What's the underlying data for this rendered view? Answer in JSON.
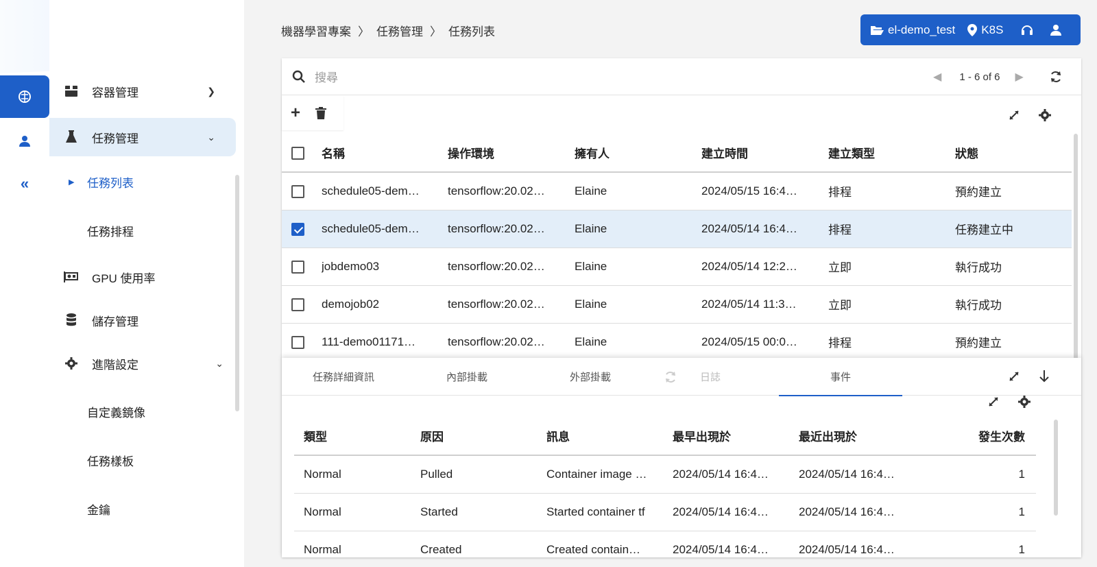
{
  "colors": {
    "primary": "#1e5fc8",
    "selected_row": "#e3eef9",
    "background": "#f3f3f3"
  },
  "rail": {
    "items": [
      "brain-icon",
      "user-icon",
      "double-chevron-left-icon"
    ]
  },
  "sidebar": {
    "items": [
      {
        "label": "容器管理",
        "icon": "box-icon"
      },
      {
        "label": "任務管理",
        "icon": "flask-icon"
      },
      {
        "label": "任務列表"
      },
      {
        "label": "任務排程"
      },
      {
        "label": "GPU 使用率",
        "icon": "gpu-card-icon"
      },
      {
        "label": "儲存管理",
        "icon": "database-icon"
      },
      {
        "label": "進階設定",
        "icon": "gear-icon"
      },
      {
        "label": "自定義鏡像"
      },
      {
        "label": "任務樣板"
      },
      {
        "label": "金鑰"
      }
    ]
  },
  "breadcrumb": [
    "機器學習專案",
    "〉",
    "任務管理",
    "〉",
    "任務列表"
  ],
  "topbar": {
    "project": "el-demo_test",
    "cluster": "K8S"
  },
  "search": {
    "placeholder": "搜尋"
  },
  "pager": {
    "range": "1 - 6 of 6"
  },
  "jobs": {
    "columns": [
      "名稱",
      "操作環境",
      "擁有人",
      "建立時間",
      "建立類型",
      "狀態"
    ],
    "rows": [
      {
        "checked": false,
        "cells": [
          "schedule05-dem…",
          "tensorflow:20.02…",
          "Elaine",
          "2024/05/15 16:4…",
          "排程",
          "預約建立"
        ]
      },
      {
        "checked": true,
        "cells": [
          "schedule05-dem…",
          "tensorflow:20.02…",
          "Elaine",
          "2024/05/14 16:4…",
          "排程",
          "任務建立中"
        ]
      },
      {
        "checked": false,
        "cells": [
          "jobdemo03",
          "tensorflow:20.02…",
          "Elaine",
          "2024/05/14 12:2…",
          "立即",
          "執行成功"
        ]
      },
      {
        "checked": false,
        "cells": [
          "demojob02",
          "tensorflow:20.02…",
          "Elaine",
          "2024/05/14 11:3…",
          "立即",
          "執行成功"
        ]
      },
      {
        "checked": false,
        "cells": [
          "111-demo01171…",
          "tensorflow:20.02…",
          "Elaine",
          "2024/05/15 00:0…",
          "排程",
          "預約建立"
        ]
      }
    ]
  },
  "detail": {
    "tabs": [
      "任務詳細資訊",
      "內部掛載",
      "外部掛載",
      "日誌",
      "事件"
    ],
    "active_tab": "事件",
    "events": {
      "columns": [
        "類型",
        "原因",
        "訊息",
        "最早出現於",
        "最近出現於",
        "發生次數"
      ],
      "rows": [
        [
          "Normal",
          "Pulled",
          "Container image …",
          "2024/05/14 16:4…",
          "2024/05/14 16:4…",
          "1"
        ],
        [
          "Normal",
          "Started",
          "Started container tf",
          "2024/05/14 16:4…",
          "2024/05/14 16:4…",
          "1"
        ],
        [
          "Normal",
          "Created",
          "Created contain…",
          "2024/05/14 16:4…",
          "2024/05/14 16:4…",
          "1"
        ]
      ]
    }
  }
}
